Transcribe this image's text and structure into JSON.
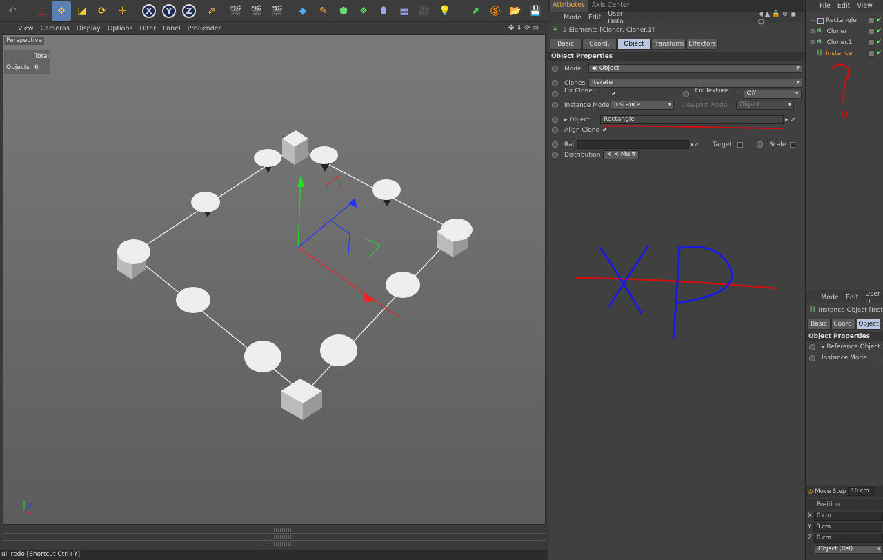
{
  "toolbar": {
    "axis_x": "X",
    "axis_y": "Y",
    "axis_z": "Z"
  },
  "viewport_menu": [
    "View",
    "Cameras",
    "Display",
    "Options",
    "Filter",
    "Panel",
    "ProRender"
  ],
  "viewport": {
    "label": "Perspective",
    "hud_total": "Total",
    "hud_objects_label": "Objects",
    "hud_objects_value": "6"
  },
  "status_text": "ull redo [Shortcut Ctrl+Y]",
  "attributes": {
    "tabs": [
      "Attributes",
      "Axis Center"
    ],
    "menu": [
      "Mode",
      "Edit",
      "User Data"
    ],
    "title": "2 Elements [Cloner, Cloner.1]",
    "subtabs": [
      "Basic",
      "Coord.",
      "Object",
      "Transform",
      "Effectors"
    ],
    "section": "Object Properties",
    "mode_label": "Mode",
    "mode_value": "Object",
    "clones_label": "Clones",
    "clones_value": "Iterate",
    "fix_clone_label": "Fix Clone . . . . .",
    "fix_texture_label": "Fix Texture . . . .",
    "fix_texture_value": "Off",
    "instance_mode_label": "Instance Mode",
    "instance_mode_value": "Instance",
    "viewport_mode_label": "Viewport Mode",
    "viewport_mode_value": "Object",
    "object_label": "Object . .",
    "object_value": "Rectangle",
    "align_clone_label": "Align Clone",
    "rail_label": "Rail",
    "target_label": "Target",
    "scale_label": "Scale",
    "distribution_label": "Distribution",
    "distribution_value": "< < Mult"
  },
  "object_manager": {
    "menu": [
      "File",
      "Edit",
      "View"
    ],
    "items": [
      {
        "name": "Rectangle",
        "color": "#cfcfcf"
      },
      {
        "name": "Cloner",
        "color": "#cfcfcf"
      },
      {
        "name": "Cloner.1",
        "color": "#cfcfcf"
      },
      {
        "name": "Instance",
        "color": "#f0a030"
      }
    ]
  },
  "attributes2": {
    "menu": [
      "Mode",
      "Edit",
      "User D"
    ],
    "title": "Instance Object [Insta",
    "subtabs": [
      "Basic",
      "Coord.",
      "Object"
    ],
    "section": "Object Properties",
    "reference_label": "Reference Object",
    "instance_mode_label": "Instance Mode . . . ."
  },
  "coordinates": {
    "move_step_label": "Move Step",
    "move_step_value": "10 cm",
    "section": "Position",
    "x_label": "X",
    "x_value": "0 cm",
    "y_label": "Y",
    "y_value": "0 cm",
    "z_label": "Z",
    "z_value": "0 cm",
    "footer": "Object (Rel)"
  },
  "annotations": {
    "question": "?",
    "xp": "XP"
  }
}
